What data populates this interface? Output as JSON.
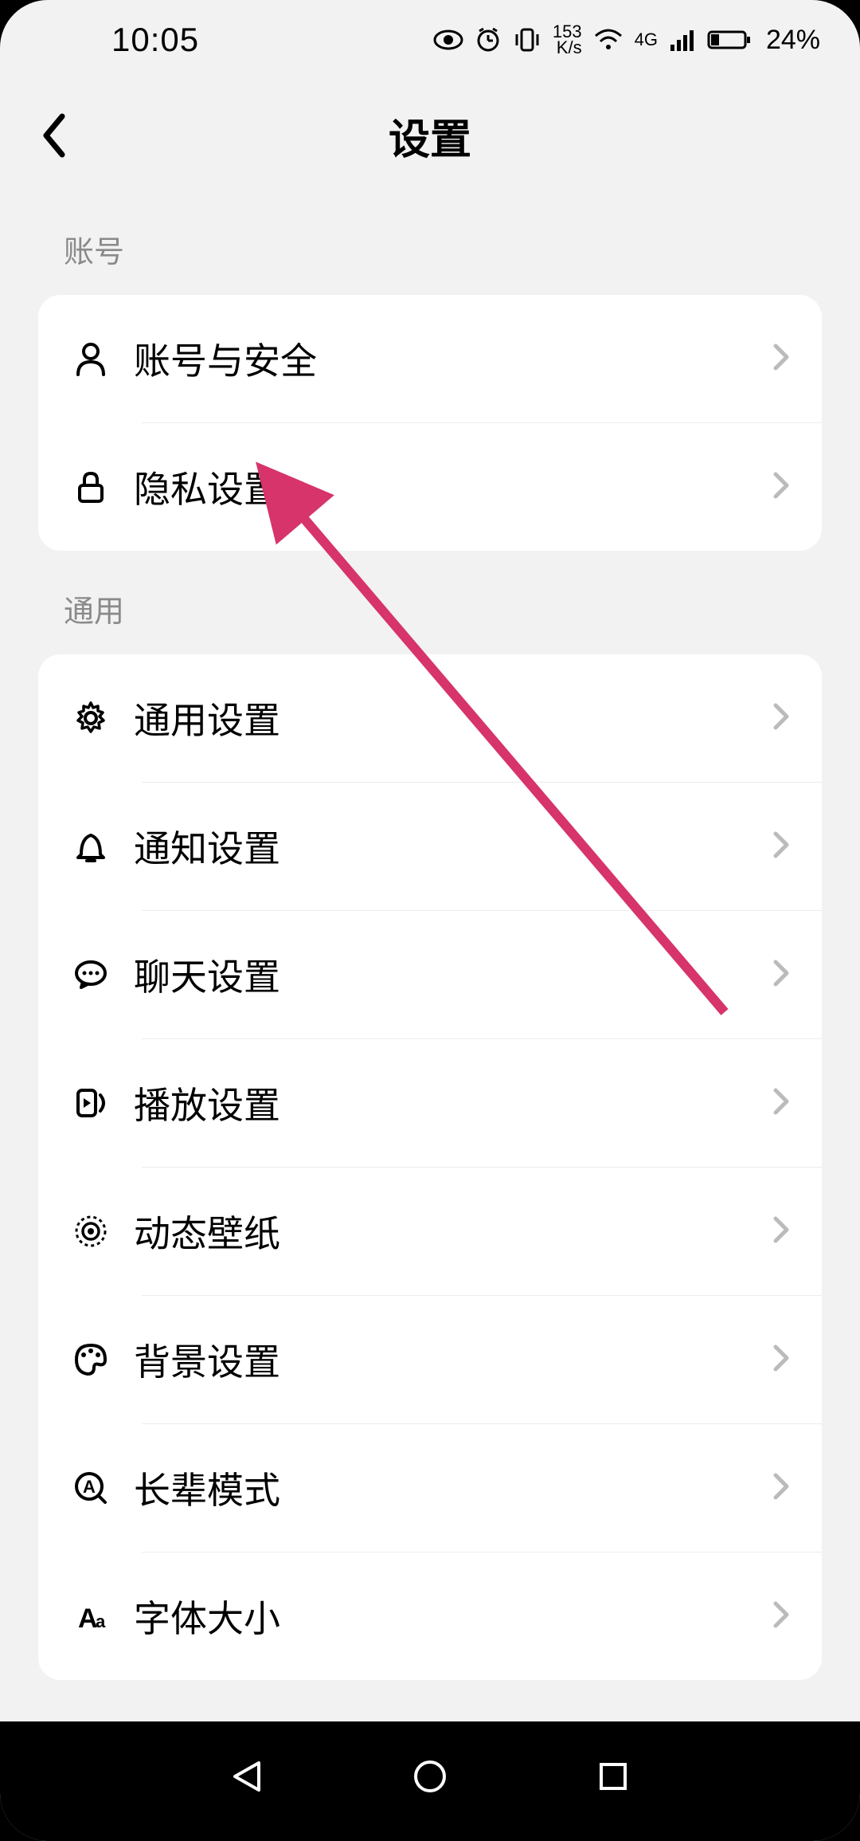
{
  "status_bar": {
    "time": "10:05",
    "net_speed_value": "153",
    "net_speed_unit": "K/s",
    "net_type": "4G",
    "battery_pct": "24%"
  },
  "header": {
    "title": "设置"
  },
  "sections": {
    "account": {
      "label": "账号",
      "items": [
        {
          "icon": "person-icon",
          "label": "账号与安全"
        },
        {
          "icon": "lock-icon",
          "label": "隐私设置"
        }
      ]
    },
    "general": {
      "label": "通用",
      "items": [
        {
          "icon": "gear-icon",
          "label": "通用设置"
        },
        {
          "icon": "bell-icon",
          "label": "通知设置"
        },
        {
          "icon": "chat-icon",
          "label": "聊天设置"
        },
        {
          "icon": "play-icon",
          "label": "播放设置"
        },
        {
          "icon": "wallpaper-icon",
          "label": "动态壁纸"
        },
        {
          "icon": "palette-icon",
          "label": "背景设置"
        },
        {
          "icon": "elder-icon",
          "label": "长辈模式"
        },
        {
          "icon": "font-icon",
          "label": "字体大小"
        }
      ]
    }
  },
  "annotation": {
    "arrow_color": "#d6346b"
  }
}
